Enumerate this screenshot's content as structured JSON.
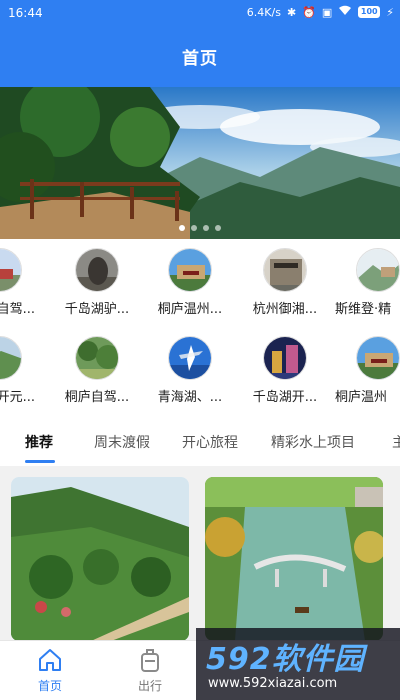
{
  "status_bar": {
    "time": "16:44",
    "speed": "6.4K/s",
    "battery": "100"
  },
  "header": {
    "title": "首页"
  },
  "banner": {
    "dots": 4,
    "active_dot": 0
  },
  "categories_row1": [
    {
      "label": "自驾...",
      "icon": "road-trip-photo"
    },
    {
      "label": "千岛湖驴...",
      "icon": "donkey-photo"
    },
    {
      "label": "桐庐温州...",
      "icon": "park-gate-photo"
    },
    {
      "label": "杭州御湘...",
      "icon": "building-photo"
    },
    {
      "label": "斯维登·精",
      "icon": "mountain-photo"
    }
  ],
  "categories_row2": [
    {
      "label": "开元...",
      "icon": "hillside-photo"
    },
    {
      "label": "桐庐自驾...",
      "icon": "forest-photo"
    },
    {
      "label": "青海湖、...",
      "icon": "dancer-photo"
    },
    {
      "label": "千岛湖开...",
      "icon": "night-city-photo"
    },
    {
      "label": "桐庐温州",
      "icon": "park-gate-photo"
    }
  ],
  "tabs": [
    {
      "label": "推荐",
      "active": true
    },
    {
      "label": "周末渡假",
      "active": false
    },
    {
      "label": "开心旅程",
      "active": false
    },
    {
      "label": "精彩水上项目",
      "active": false
    },
    {
      "label": "主",
      "active": false
    }
  ],
  "bottom_nav": [
    {
      "label": "首页",
      "icon": "home-icon",
      "active": true
    },
    {
      "label": "出行",
      "icon": "luggage-icon",
      "active": false
    }
  ],
  "watermark": {
    "brand": "592软件园",
    "url": "www.592xiazai.com"
  },
  "colors": {
    "primary": "#2f7ff2",
    "background": "#f1f1f1"
  }
}
